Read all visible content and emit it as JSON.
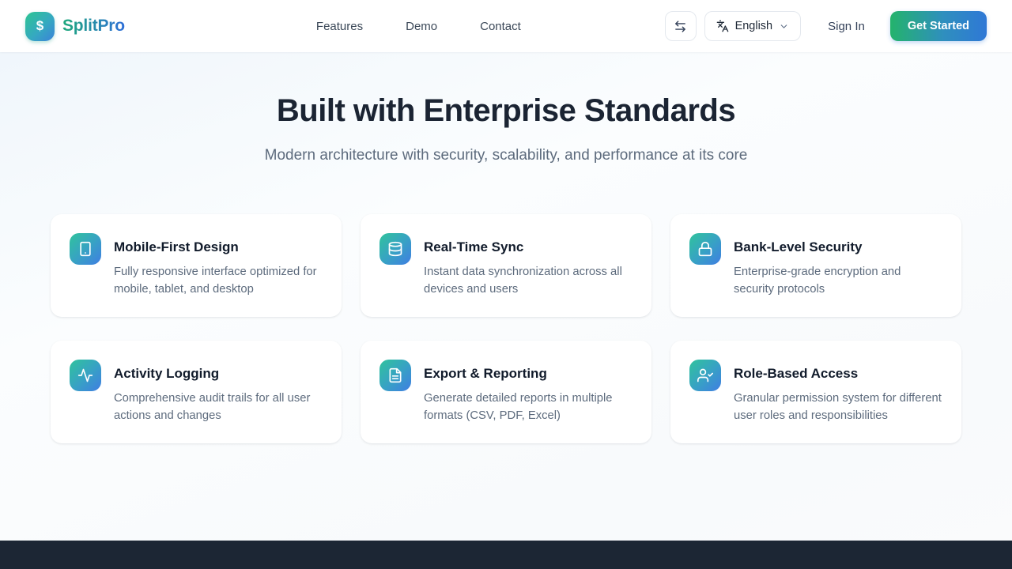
{
  "brand": {
    "name": "SplitPro",
    "logo_symbol": "$"
  },
  "nav": {
    "items": [
      {
        "label": "Features"
      },
      {
        "label": "Demo"
      },
      {
        "label": "Contact"
      }
    ]
  },
  "header_actions": {
    "language": {
      "selected": "English"
    },
    "sign_in_label": "Sign In",
    "get_started_label": "Get Started"
  },
  "hero": {
    "title": "Built with Enterprise Standards",
    "subtitle": "Modern architecture with security, scalability, and performance at its core"
  },
  "features": {
    "cards": [
      {
        "icon": "smartphone-icon",
        "title": "Mobile-First Design",
        "description": "Fully responsive interface optimized for mobile, tablet, and desktop"
      },
      {
        "icon": "database-icon",
        "title": "Real-Time Sync",
        "description": "Instant data synchronization across all devices and users"
      },
      {
        "icon": "lock-icon",
        "title": "Bank-Level Security",
        "description": "Enterprise-grade encryption and security protocols"
      },
      {
        "icon": "activity-icon",
        "title": "Activity Logging",
        "description": "Comprehensive audit trails for all user actions and changes"
      },
      {
        "icon": "file-text-icon",
        "title": "Export & Reporting",
        "description": "Generate detailed reports in multiple formats (CSV, PDF, Excel)"
      },
      {
        "icon": "user-check-icon",
        "title": "Role-Based Access",
        "description": "Granular permission system for different user roles and responsibilities"
      }
    ]
  },
  "colors": {
    "gradient_start": "#2ec592",
    "gradient_end": "#3b82d9",
    "cta_green": "#24b36c",
    "cta_blue": "#2f78d6",
    "heading": "#1b2433",
    "muted_text": "#5d6b7d",
    "footer_bg": "#1c2634"
  }
}
